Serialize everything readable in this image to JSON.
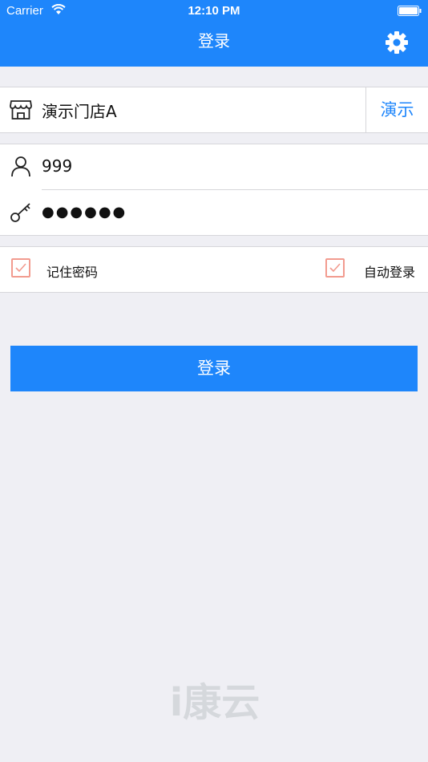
{
  "status_bar": {
    "carrier": "Carrier",
    "time": "12:10 PM"
  },
  "nav": {
    "title": "登录"
  },
  "store": {
    "name": "演示门店A",
    "demo_label": "演示"
  },
  "credentials": {
    "username": "999",
    "password_mask": "●●●●●●"
  },
  "options": {
    "remember_label": "记住密码",
    "auto_login_label": "自动登录",
    "remember_checked": true,
    "auto_login_checked": true
  },
  "login_button": {
    "label": "登录"
  },
  "footer": {
    "logo_text": "i康云"
  },
  "colors": {
    "primary": "#1e86fb",
    "background": "#efeff4",
    "checkbox": "#f29b8f",
    "logo": "#d5d8dc"
  }
}
